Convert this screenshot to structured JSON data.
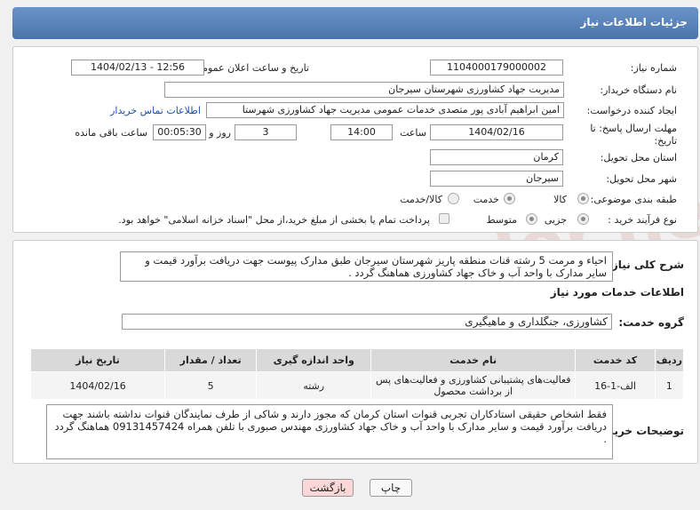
{
  "header": {
    "title": "جزئیات اطلاعات نیاز"
  },
  "fields": {
    "need_number_label": "شماره نیاز:",
    "need_number": "1104000179000002",
    "announce_label": "تاریخ و ساعت اعلان عمومی:",
    "announce_value": "1404/02/13 - 12:56",
    "buyer_org_label": "نام دستگاه خریدار:",
    "buyer_org": "مدیریت جهاد کشاورزی شهرستان سیرجان",
    "creator_label": "ایجاد کننده درخواست:",
    "creator": "امین ابراهیم آبادی پور متصدی خدمات عمومی مدیریت جهاد کشاورزی شهرستا",
    "contact_link": "اطلاعات تماس خریدار",
    "deadline_label_1": "مهلت ارسال پاسخ: تا",
    "deadline_label_2": "تاریخ:",
    "deadline_date": "1404/02/16",
    "time_label": "ساعت",
    "deadline_time": "14:00",
    "days_value": "3",
    "days_label": "روز و",
    "remaining_time": "00:05:30",
    "remaining_label": "ساعت باقی مانده",
    "province_label": "استان محل تحویل:",
    "province": "کرمان",
    "city_label": "شهر محل تحویل:",
    "city": "سیرجان",
    "category_label": "طبقه بندی موضوعی:",
    "category_options": [
      "کالا",
      "خدمت",
      "کالا/خدمت"
    ],
    "purchase_type_label": "نوع فرآیند خرید :",
    "purchase_options": [
      "جزیی",
      "متوسط"
    ],
    "payment_note": "پرداخت تمام یا بخشی از مبلغ خرید،از محل \"اسناد خزانه اسلامی\" خواهد بود."
  },
  "description": {
    "label": "شرح کلی نیاز:",
    "text": "احیاء و مرمت 5 رشته قنات منطقه پاریز شهرستان سیرجان طبق مدارک پیوست جهت دریافت برآورد قیمت و سایر مدارک با واحد آب و خاک جهاد کشاورزی هماهنگ گردد ."
  },
  "services": {
    "section_title": "اطلاعات خدمات مورد نیاز",
    "group_label": "گروه خدمت:",
    "group_value": "کشاورزی، جنگلداری و ماهیگیری",
    "columns": [
      "ردیف",
      "کد خدمت",
      "نام خدمت",
      "واحد اندازه گیری",
      "تعداد / مقدار",
      "تاریخ نیاز"
    ],
    "rows": [
      [
        "1",
        "الف-1-16",
        "فعالیت‌های پشتیبانی کشاورزی و فعالیت‌های پس از برداشت محصول",
        "رشته",
        "5",
        "1404/02/16"
      ]
    ]
  },
  "buyer_notes": {
    "label": "توضیحات خریدار:",
    "text": "فقط اشخاص حقیقی استادکاران تجربی قنوات استان کرمان که مجوز دارند و شاکی از طرف نمایندگان قنوات نداشته باشند جهت دریافت برآورد قیمت و سایر مدارک با واحد آب و خاک جهاد کشاورزی مهندس صبوری با تلفن همراه 09131457424 هماهنگ گردد ."
  },
  "buttons": {
    "print": "چاپ",
    "back": "بازگشت"
  },
  "watermark": "AriaTender.net",
  "colors": {
    "header": "#5a83bb",
    "link": "#1a4fb3",
    "back_button": "#fbd7d7"
  }
}
